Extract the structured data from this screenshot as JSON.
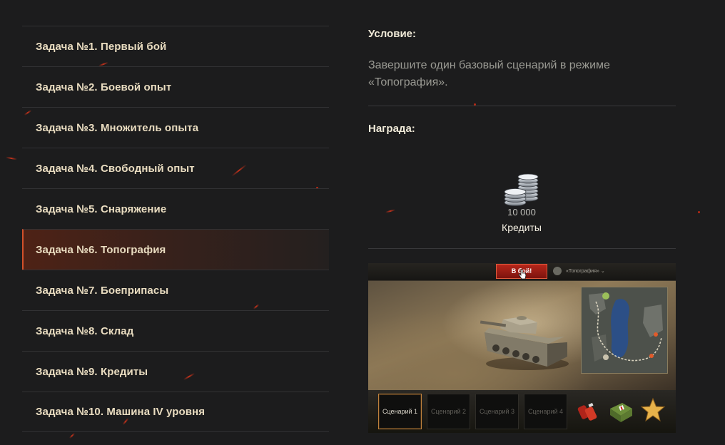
{
  "tasks": [
    {
      "label": "Задача №1. Первый бой",
      "active": false
    },
    {
      "label": "Задача №2. Боевой опыт",
      "active": false
    },
    {
      "label": "Задача №3. Множитель опыта",
      "active": false
    },
    {
      "label": "Задача №4. Свободный опыт",
      "active": false
    },
    {
      "label": "Задача №5. Снаряжение",
      "active": false
    },
    {
      "label": "Задача №6. Топография",
      "active": true
    },
    {
      "label": "Задача №7. Боеприпасы",
      "active": false
    },
    {
      "label": "Задача №8. Склад",
      "active": false
    },
    {
      "label": "Задача №9. Кредиты",
      "active": false
    },
    {
      "label": "Задача №10. Машина IV уровня",
      "active": false
    }
  ],
  "condition": {
    "heading": "Условие:",
    "text": "Завершите один базовый сценарий в режиме «Топография»."
  },
  "reward": {
    "heading": "Награда:",
    "amount": "10 000",
    "label": "Кредиты",
    "icon": "credits-coins-icon"
  },
  "preview": {
    "battle_button": "В бой!",
    "mode_label": "«Топография» ⌄",
    "scenarios": [
      {
        "label": "Сценарий 1",
        "selected": true
      },
      {
        "label": "Сценарий 2",
        "selected": false
      },
      {
        "label": "Сценарий 3",
        "selected": false
      },
      {
        "label": "Сценарий 4",
        "selected": false
      }
    ],
    "icons": [
      "first-aid-kit-icon",
      "supply-box-icon",
      "star-icon"
    ]
  },
  "colors": {
    "background": "#1c1c1d",
    "task_text": "#e9dcc0",
    "accent": "#d2502a",
    "muted_text": "#9a9a93"
  }
}
